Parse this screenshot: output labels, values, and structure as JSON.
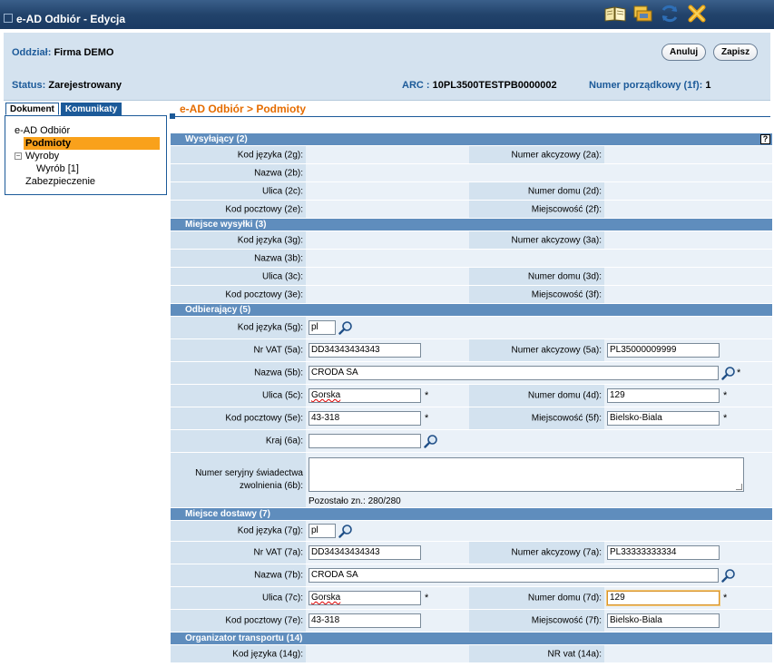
{
  "window": {
    "title": "e-AD Odbiór - Edycja"
  },
  "toolbar_icons": [
    "book-icon",
    "folder-icon",
    "refresh-icon",
    "close-icon"
  ],
  "header": {
    "oddzial_label": "Oddział:",
    "oddzial_value": "Firma DEMO",
    "status_label": "Status:",
    "status_value": "Zarejestrowany",
    "arc_label": "ARC :",
    "arc_value": "10PL3500TESTPB0000002",
    "numer_label": "Numer porządkowy (1f):",
    "numer_value": "1",
    "cancel_label": "Anuluj",
    "save_label": "Zapisz"
  },
  "tabs": [
    {
      "label": "Dokument",
      "active": true
    },
    {
      "label": "Komunikaty",
      "active": false
    }
  ],
  "tree": {
    "root": "e-AD Odbiór",
    "selected": "Podmioty",
    "wyroby": "Wyroby",
    "wyrob": "Wyrób [1]",
    "zabezpieczenie": "Zabezpieczenie"
  },
  "breadcrumb": "e-AD Odbiór > Podmioty",
  "sections": {
    "wysylajacy": {
      "title": "Wysyłający (2)",
      "kod_jezyka": "Kod języka (2g):",
      "numer_akcyzowy": "Numer akcyzowy (2a):",
      "nazwa": "Nazwa (2b):",
      "ulica": "Ulica (2c):",
      "numer_domu": "Numer domu (2d):",
      "kod_pocztowy": "Kod pocztowy (2e):",
      "miejscowosc": "Miejscowość (2f):"
    },
    "miejsce_wysylki": {
      "title": "Miejsce wysyłki (3)",
      "kod_jezyka": "Kod języka (3g):",
      "numer_akcyzowy": "Numer akcyzowy (3a):",
      "nazwa": "Nazwa (3b):",
      "ulica": "Ulica (3c):",
      "numer_domu": "Numer domu (3d):",
      "kod_pocztowy": "Kod pocztowy (3e):",
      "miejscowosc": "Miejscowość (3f):"
    },
    "odbierajacy": {
      "title": "Odbierający (5)",
      "kod_jezyka": "Kod języka (5g):",
      "kod_jezyka_value": "pl",
      "nr_vat": "Nr VAT (5a):",
      "nr_vat_value": "DD34343434343",
      "numer_akcyzowy": "Numer akcyzowy (5a):",
      "numer_akcyzowy_value": "PL35000009999",
      "nazwa": "Nazwa (5b):",
      "nazwa_value": "CRODA SA",
      "ulica": "Ulica (5c):",
      "ulica_value": "Gorska",
      "numer_domu": "Numer domu (4d):",
      "numer_domu_value": "129",
      "kod_pocztowy": "Kod pocztowy (5e):",
      "kod_pocztowy_value": "43-318",
      "miejscowosc": "Miejscowość (5f):",
      "miejscowosc_value": "Bielsko-Biala",
      "kraj": "Kraj (6a):",
      "kraj_value": "",
      "numer_seryjny": "Numer seryjny świadectwa zwolnienia (6b):",
      "pozostalo": "Pozostało zn.: 280/280"
    },
    "miejsce_dostawy": {
      "title": "Miejsce dostawy (7)",
      "kod_jezyka": "Kod języka (7g):",
      "kod_jezyka_value": "pl",
      "nr_vat": "Nr VAT (7a):",
      "nr_vat_value": "DD34343434343",
      "numer_akcyzowy": "Numer akcyzowy (7a):",
      "numer_akcyzowy_value": "PL33333333334",
      "nazwa": "Nazwa (7b):",
      "nazwa_value": "CRODA SA",
      "ulica": "Ulica (7c):",
      "ulica_value": "Gorska",
      "numer_domu": "Numer domu (7d):",
      "numer_domu_value": "129",
      "kod_pocztowy": "Kod pocztowy (7e):",
      "kod_pocztowy_value": "43-318",
      "miejscowosc": "Miejscowość (7f):",
      "miejscowosc_value": "Bielsko-Biala"
    },
    "organizator": {
      "title": "Organizator transportu (14)",
      "kod_jezyka": "Kod języka (14g):",
      "nr_vat": "NR vat (14a):"
    }
  },
  "required_marker": "*",
  "colors": {
    "accent": "#f9a11b",
    "section": "#5f8dbd",
    "brand": "#1c5a99"
  }
}
